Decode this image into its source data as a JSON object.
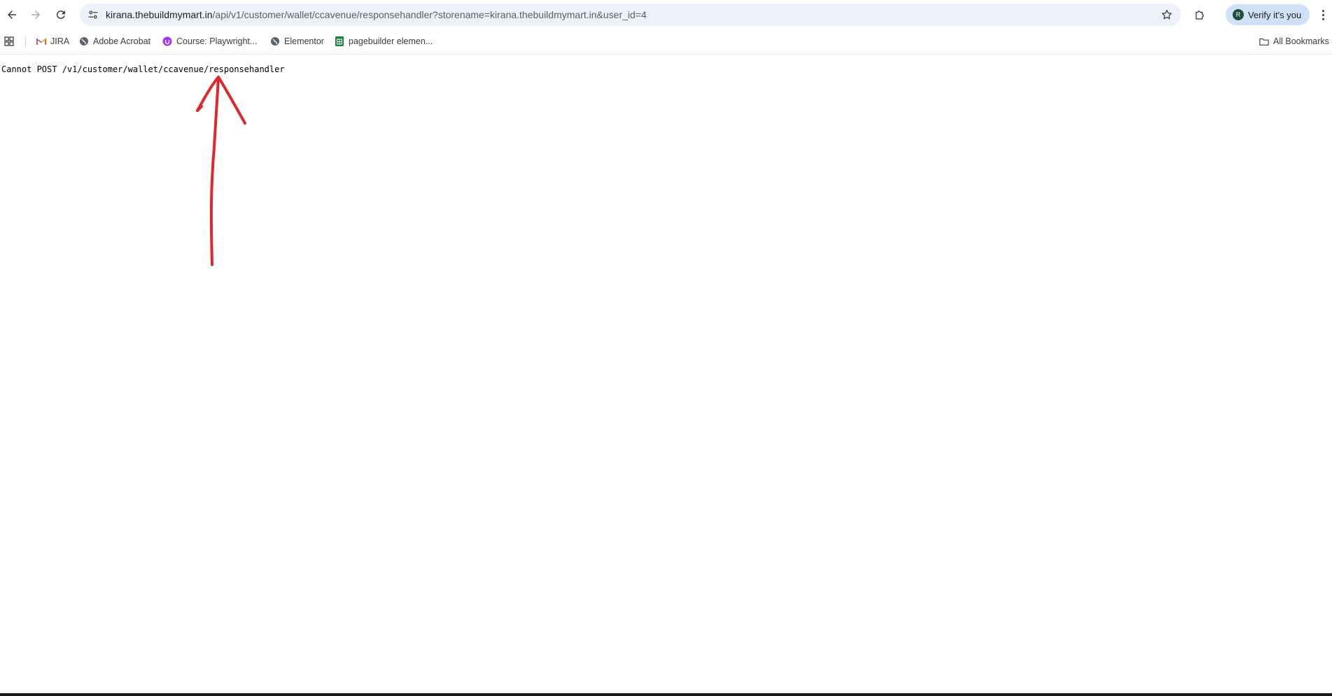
{
  "address_bar": {
    "host": "kirana.thebuildmymart.in",
    "path": "/api/v1/customer/wallet/ccavenue/responsehandler?storename=kirana.thebuildmymart.in&user_id=4"
  },
  "profile": {
    "avatar_initial": "R",
    "label": "Verify it's you"
  },
  "bookmarks": {
    "items": [
      {
        "label": "JIRA",
        "icon": "gmail-icon"
      },
      {
        "label": "Adobe Acrobat",
        "icon": "globe-icon"
      },
      {
        "label": "Course: Playwright...",
        "icon": "udemy-icon"
      },
      {
        "label": "Elementor",
        "icon": "globe-icon"
      },
      {
        "label": "pagebuilder elemen...",
        "icon": "sheets-icon"
      }
    ],
    "all_bookmarks": "All Bookmarks"
  },
  "page": {
    "message": "Cannot POST /v1/customer/wallet/ccavenue/responsehandler"
  },
  "colors": {
    "annotation": "#e3262b",
    "omnibox_bg": "#edf1f9",
    "profile_chip": "#cfe0f7"
  }
}
